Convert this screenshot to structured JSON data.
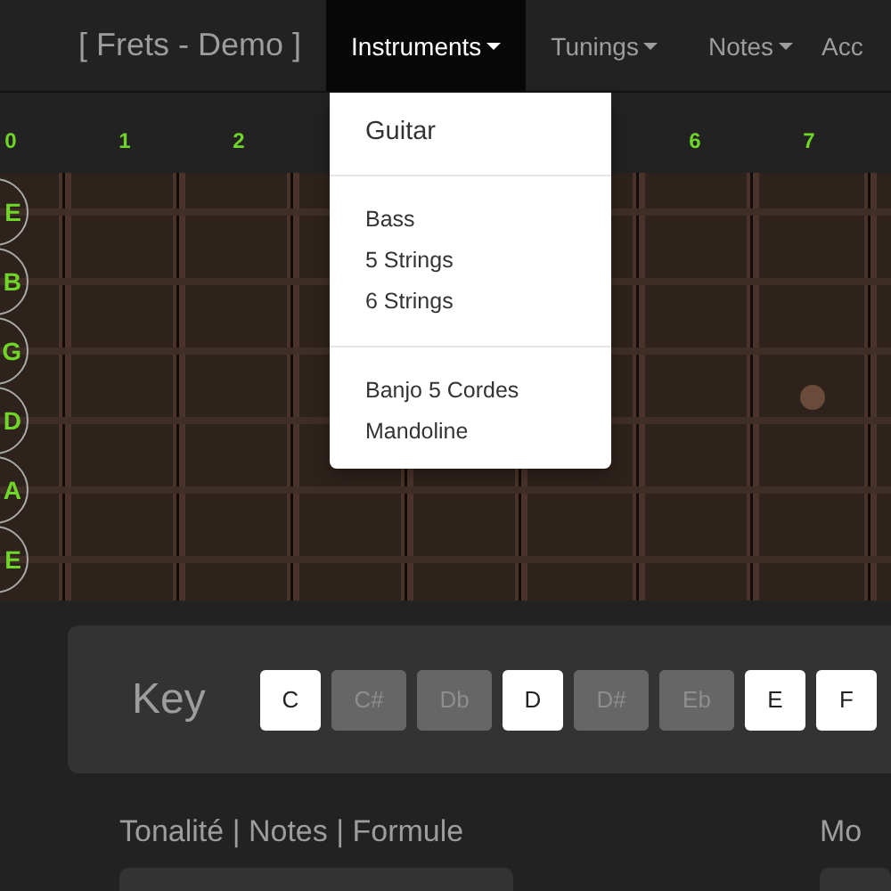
{
  "navbar": {
    "brand": "[ Frets - Demo ]",
    "items": [
      {
        "label": "Instruments",
        "selected": true
      },
      {
        "label": "Tunings",
        "selected": false
      },
      {
        "label": "Notes",
        "selected": false
      },
      {
        "label": "Acc",
        "selected": false
      }
    ]
  },
  "dropdown": {
    "sections": [
      [
        {
          "label": "Guitar",
          "kind": "large"
        }
      ],
      [
        {
          "label": "Bass",
          "kind": "normal"
        },
        {
          "label": "5 Strings",
          "kind": "normal"
        },
        {
          "label": "6 Strings",
          "kind": "normal"
        }
      ],
      [
        {
          "label": "Banjo 5 Cordes",
          "kind": "normal"
        },
        {
          "label": "Mandoline",
          "kind": "normal"
        }
      ]
    ]
  },
  "fret_numbers": [
    "0",
    "1",
    "2",
    "6",
    "7"
  ],
  "strings": [
    "E",
    "B",
    "G",
    "D",
    "A",
    "E"
  ],
  "key_panel": {
    "label": "Key",
    "notes": [
      {
        "label": "C",
        "enabled": true
      },
      {
        "label": "C#",
        "enabled": false
      },
      {
        "label": "Db",
        "enabled": false
      },
      {
        "label": "D",
        "enabled": true
      },
      {
        "label": "D#",
        "enabled": false
      },
      {
        "label": "Eb",
        "enabled": false
      },
      {
        "label": "E",
        "enabled": true
      },
      {
        "label": "F",
        "enabled": true
      }
    ]
  },
  "sections": [
    {
      "title": "Tonalité | Notes | Formule"
    },
    {
      "title": "Mo"
    }
  ]
}
